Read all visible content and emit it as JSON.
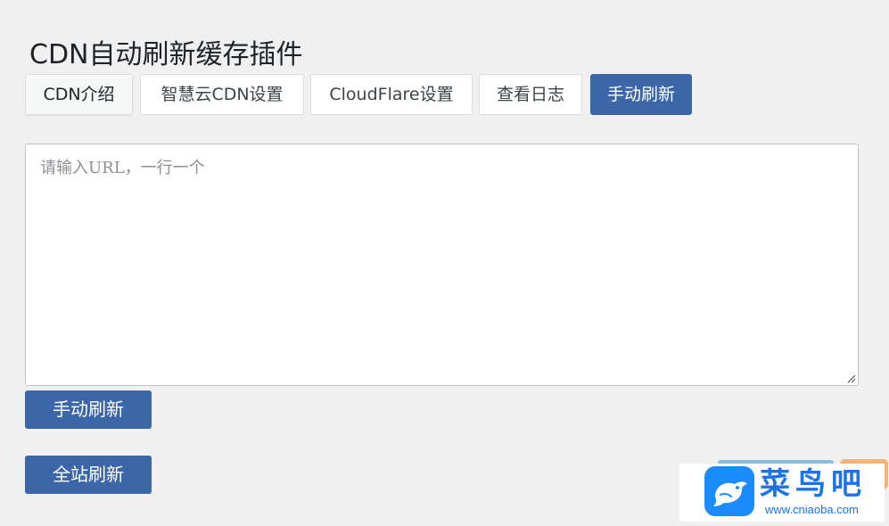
{
  "page": {
    "title": "CDN自动刷新缓存插件"
  },
  "tabs": [
    {
      "label": "CDN介绍",
      "active": false
    },
    {
      "label": "智慧云CDN设置",
      "active": false
    },
    {
      "label": "CloudFlare设置",
      "active": false
    },
    {
      "label": "查看日志",
      "active": false
    },
    {
      "label": "手动刷新",
      "active": true
    }
  ],
  "refresh_form": {
    "url_input": {
      "value": "",
      "placeholder": "请输入URL，一行一个"
    },
    "manual_refresh_label": "手动刷新",
    "full_refresh_label": "全站刷新"
  },
  "watermark": {
    "name": "菜鸟吧",
    "url": "www.cniaoba.com",
    "logo_icon": "bird-icon"
  },
  "colors": {
    "background": "#f0f0f1",
    "primary_button": "#3b67a8",
    "tab_border": "#dcdcde",
    "watermark_blue": "#1a73e8",
    "logo_blue": "#1a8cff"
  }
}
